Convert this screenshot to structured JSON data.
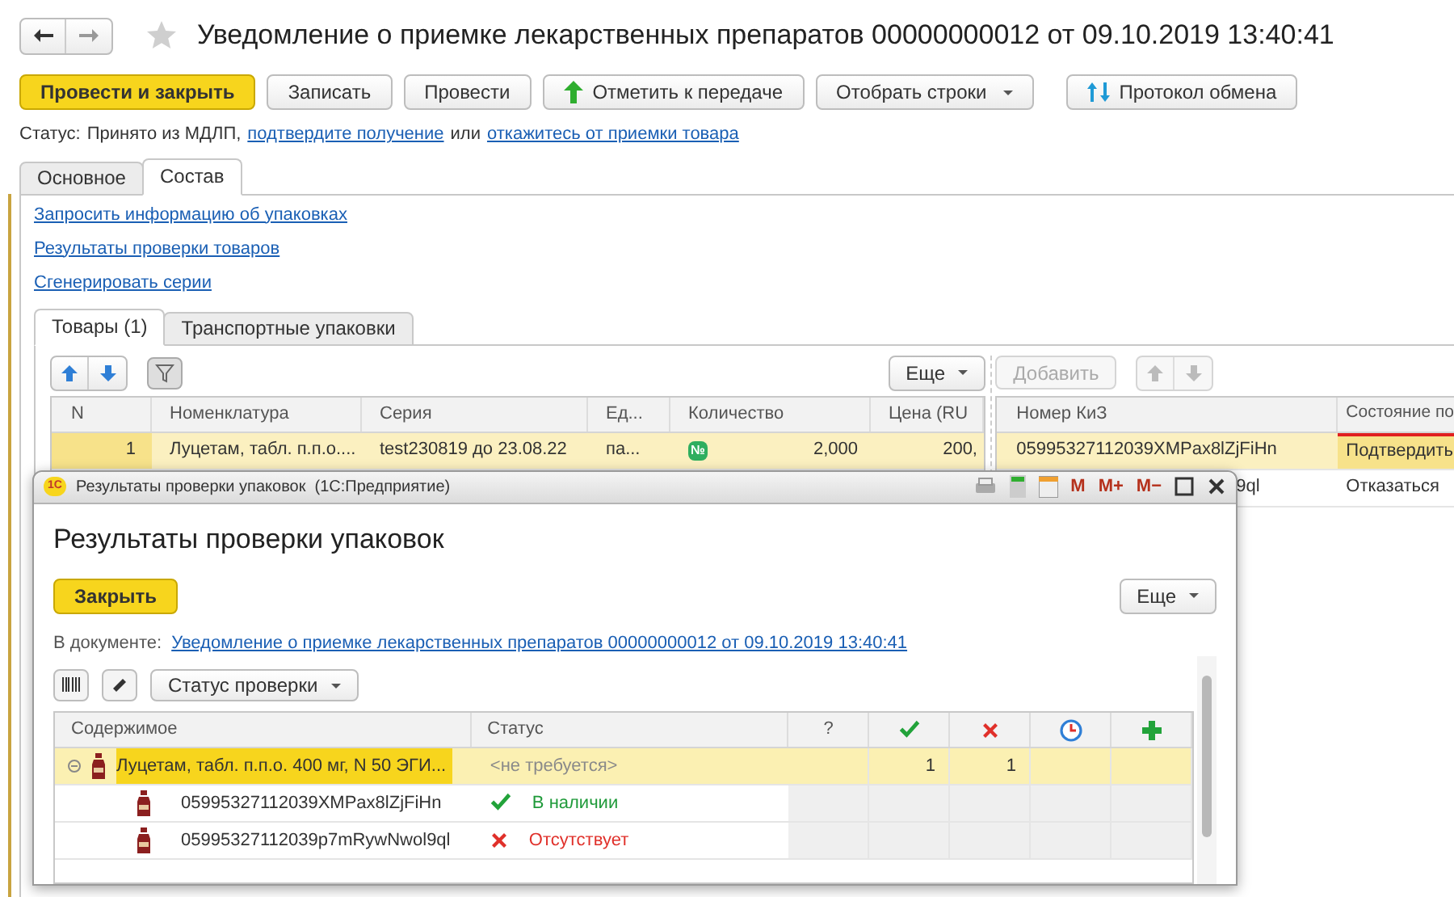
{
  "window": {
    "title": "Уведомление о приемке лекарственных препаратов 00000000012 от 09.10.2019 13:40:41"
  },
  "toolbar": [
    {
      "label": "Провести и закрыть",
      "kind": "primary"
    },
    {
      "label": "Записать",
      "kind": "plain"
    },
    {
      "label": "Провести",
      "kind": "plain"
    },
    {
      "label": "Отметить к передаче",
      "kind": "mark"
    },
    {
      "label": "Отобрать строки",
      "kind": "dropdown"
    },
    {
      "label": "Протокол обмена",
      "kind": "exchange"
    }
  ],
  "status": {
    "label": "Статус:",
    "text": "Принято из МДЛП,",
    "confirm_link": "подтвердите получение",
    "middle": "или",
    "reject_link": "откажитесь от приемки товара"
  },
  "tabs": [
    {
      "label": "Основное",
      "selected": false
    },
    {
      "label": "Состав",
      "selected": true
    }
  ],
  "links": [
    "Запросить информацию об упаковках",
    "Результаты проверки товаров",
    "Сгенерировать серии"
  ],
  "inner_tabs": [
    {
      "label": "Товары (1)",
      "selected": true
    },
    {
      "label": "Транспортные упаковки",
      "selected": false
    }
  ],
  "more_button": "Еще",
  "add_button": "Добавить",
  "goods_table": {
    "columns": [
      "N",
      "Номенклатура",
      "Серия",
      "Ед...",
      "Количество",
      "Цена (RU"
    ],
    "rows": [
      {
        "n": "1",
        "item": "Луцетам, табл. п.п.о....",
        "series": "test230819 до 23.08.22",
        "unit": "па...",
        "badge": "№",
        "quantity": "2,000",
        "price": "200,",
        "selected": true
      }
    ]
  },
  "kiz_table": {
    "columns": [
      "Номер КиЗ",
      "Состояние по"
    ],
    "rows": [
      {
        "kiz": "05995327112039XMPax8lZjFiHn",
        "state": "Подтвердить",
        "selected": true
      },
      {
        "kiz": "9ql",
        "state": "Отказаться",
        "selected": false
      }
    ]
  },
  "dialog": {
    "logo": "1С",
    "title": "Результаты проверки упаковок  (1С:Предприятие)",
    "tools": [
      "M",
      "M+",
      "M−"
    ],
    "heading": "Результаты проверки упаковок",
    "close_button": "Закрыть",
    "more_button": "Еще",
    "document_label": "В документе:",
    "document_link": "Уведомление о приемке лекарственных препаратов 00000000012 от 09.10.2019 13:40:41",
    "status_filter": "Статус проверки",
    "columns": [
      {
        "kind": "text",
        "label": "Содержимое"
      },
      {
        "kind": "text",
        "label": "Статус"
      },
      {
        "kind": "text",
        "label": "?"
      },
      {
        "kind": "ok"
      },
      {
        "kind": "missing"
      },
      {
        "kind": "pending"
      },
      {
        "kind": "added"
      }
    ],
    "rows": [
      {
        "content": "Луцетам, табл. п.п.о. 400 мг, N 50 ЭГИ...",
        "status": "<не требуется>",
        "ok": "1",
        "missing": "1",
        "expanded": true,
        "selected": true,
        "children": [
          {
            "content": "05995327112039XMPax8lZjFiHn",
            "status": "В наличии",
            "kind": "present"
          },
          {
            "content": "05995327112039p7mRywNwol9ql",
            "status": "Отсутствует",
            "kind": "absent"
          }
        ]
      }
    ]
  }
}
